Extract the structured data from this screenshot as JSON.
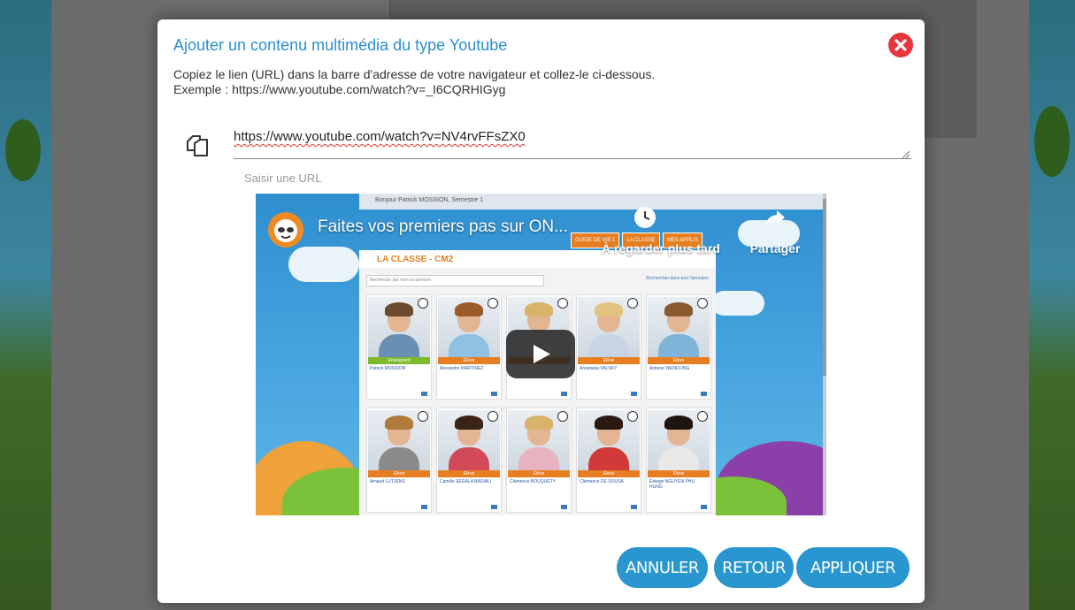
{
  "modal": {
    "title": "Ajouter un contenu multimédia du type Youtube",
    "instruction_line1": "Copiez le lien (URL) dans la barre d'adresse de votre navigateur et collez-le ci-dessous.",
    "instruction_line2": "Exemple : https://www.youtube.com/watch?v=_I6CQRHIGyg",
    "url_value": "https://www.youtube.com/watch?v=NV4rvFFsZX0",
    "url_label": "Saisir une URL",
    "close_icon": "close-icon",
    "copy_icon": "copy-icon"
  },
  "video": {
    "title": "Faites vos premiers pas sur ON...",
    "watch_later": "À regarder plus tard",
    "share": "Partager",
    "app_topbar": "Bonjour Patrick MOSSION, Semestre 1",
    "app_title": "LA CLASSE - CM2",
    "search_placeholder": "Recherche par nom ou prénom",
    "search_link": "Rechercher dans tout l'annuaire",
    "tabs": [
      "GUIDE DE VIE 1",
      "LA CLASSE",
      "MES APPLIS"
    ],
    "cards": [
      {
        "role": "Enseignant",
        "name": "Patrick MOSSION",
        "role_color": "#7dbb2a",
        "hair": "#6b4a2e",
        "shirt": "#6a8fb5"
      },
      {
        "role": "Élève",
        "name": "Alexandre MARTINEZ",
        "role_color": "#e77e22",
        "hair": "#9a5a2a",
        "shirt": "#8fc1e3"
      },
      {
        "role": "Élève",
        "name": "",
        "role_color": "#e77e22",
        "hair": "#d9b36a",
        "shirt": "#e8e0d8"
      },
      {
        "role": "Élève",
        "name": "Anastasia VALSKY",
        "role_color": "#e77e22",
        "hair": "#e2c47f",
        "shirt": "#c8d4e6"
      },
      {
        "role": "Élève",
        "name": "Antoine WENDLING",
        "role_color": "#e77e22",
        "hair": "#8a5a30",
        "shirt": "#7fb3d8"
      },
      {
        "role": "Élève",
        "name": "Arnaud LUTJENS",
        "role_color": "#e77e22",
        "hair": "#b07a3a",
        "shirt": "#8a8a8a"
      },
      {
        "role": "Élève",
        "name": "Camille SEGALA BADIALI",
        "role_color": "#e77e22",
        "hair": "#3a2418",
        "shirt": "#d24a5a"
      },
      {
        "role": "Élève",
        "name": "Clémence BOUQUETY",
        "role_color": "#e77e22",
        "hair": "#d9b36a",
        "shirt": "#e7b3c0"
      },
      {
        "role": "Élève",
        "name": "Clémence DE SOUSA",
        "role_color": "#e77e22",
        "hair": "#2a1a12",
        "shirt": "#d23a3a"
      },
      {
        "role": "Élève",
        "name": "Edwige NGUYEN PHU HUNG",
        "role_color": "#e77e22",
        "hair": "#1e1410",
        "shirt": "#e8e8e8"
      }
    ]
  },
  "buttons": {
    "cancel": "ANNULER",
    "back": "RETOUR",
    "apply": "APPLIQUER"
  },
  "colors": {
    "accent": "#2a96cf",
    "title": "#2a8fd1",
    "close": "#e8353c",
    "orange": "#e77e22"
  }
}
